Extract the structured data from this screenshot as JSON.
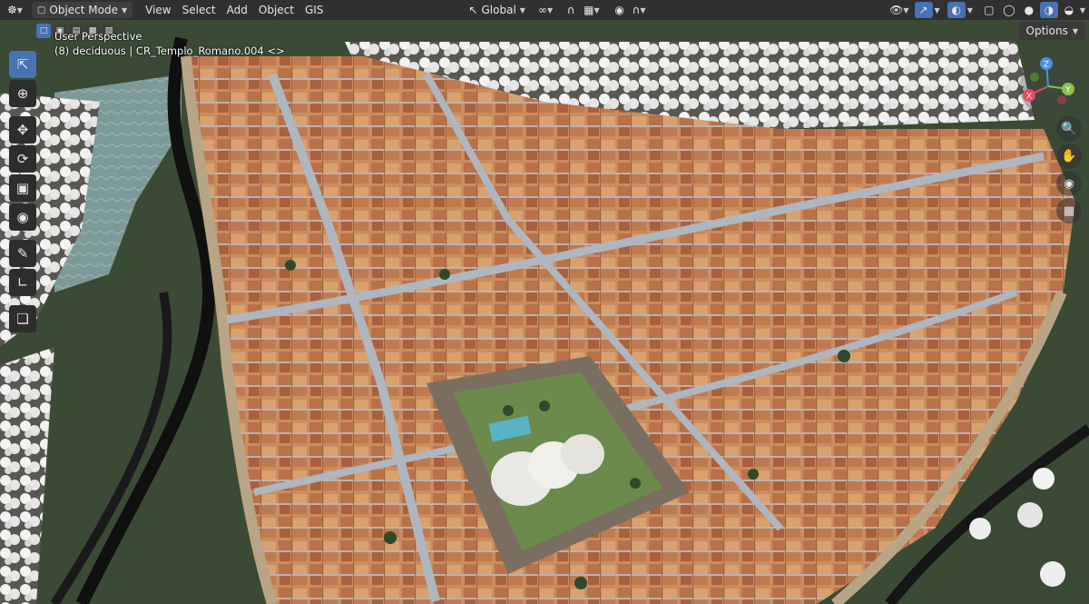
{
  "header": {
    "mode_label": "Object Mode",
    "menus": [
      "View",
      "Select",
      "Add",
      "Object",
      "GIS"
    ],
    "transform_orientation": "Global"
  },
  "viewport": {
    "perspective_label": "User Perspective",
    "object_label": "(8) deciduous | CR_Templo_Romano.004 <>",
    "options_label": "Options"
  },
  "gizmo": {
    "x_label": "X",
    "y_label": "Y",
    "z_label": "Z"
  },
  "colors": {
    "header_bg": "#303030",
    "accent_active": "#4772b3",
    "axis_x": "#e84a5f",
    "axis_y": "#8bc34a",
    "axis_z": "#4a90e2"
  }
}
